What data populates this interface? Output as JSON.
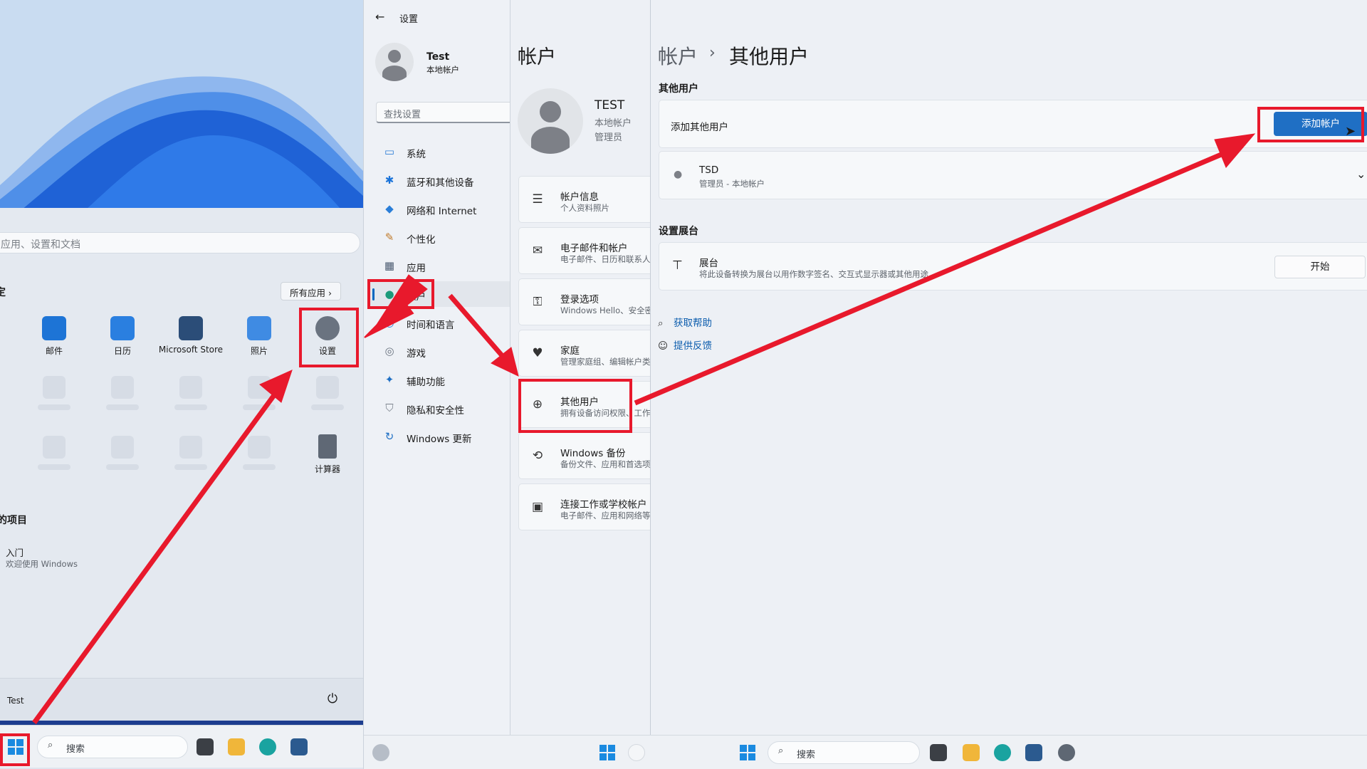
{
  "start_menu": {
    "search_placeholder": "应用、设置和文档",
    "pinned_title": "定",
    "all_apps_label": "所有应用",
    "apps": [
      {
        "label": "邮件"
      },
      {
        "label": "日历"
      },
      {
        "label": "Microsoft Store"
      },
      {
        "label": "照片"
      },
      {
        "label": "设置"
      },
      {
        "label": "计算器"
      }
    ],
    "recommended_title": "的项目",
    "recommended_item": {
      "name": "入门",
      "desc": "欢迎使用 Windows"
    },
    "user_name": "Test",
    "power_icon": "power-icon"
  },
  "taskbar": {
    "search_label": "搜索"
  },
  "settings_nav": {
    "title": "设置",
    "user_name": "Test",
    "user_type": "本地帐户",
    "find_placeholder": "查找设置",
    "items": [
      {
        "label": "系统",
        "icon": "system-icon"
      },
      {
        "label": "蓝牙和其他设备",
        "icon": "bluetooth-icon"
      },
      {
        "label": "网络和 Internet",
        "icon": "wifi-icon"
      },
      {
        "label": "个性化",
        "icon": "brush-icon"
      },
      {
        "label": "应用",
        "icon": "apps-icon"
      },
      {
        "label": "帐户",
        "icon": "person-icon",
        "selected": true
      },
      {
        "label": "时间和语言",
        "icon": "clock-icon"
      },
      {
        "label": "游戏",
        "icon": "gamepad-icon"
      },
      {
        "label": "辅助功能",
        "icon": "accessibility-icon"
      },
      {
        "label": "隐私和安全性",
        "icon": "shield-icon"
      },
      {
        "label": "Windows 更新",
        "icon": "update-icon"
      }
    ]
  },
  "accounts": {
    "title": "帐户",
    "user_name": "TEST",
    "user_type": "本地帐户",
    "user_role": "管理员",
    "items": [
      {
        "title": "帐户信息",
        "desc": "个人资料照片"
      },
      {
        "title": "电子邮件和帐户",
        "desc": "电子邮件、日历和联系人"
      },
      {
        "title": "登录选项",
        "desc": "Windows Hello、安全密"
      },
      {
        "title": "家庭",
        "desc": "管理家庭组、编辑帐户类"
      },
      {
        "title": "其他用户",
        "desc": "拥有设备访问权限、工作"
      },
      {
        "title": "Windows 备份",
        "desc": "备份文件、应用和首选项"
      },
      {
        "title": "连接工作或学校帐户",
        "desc": "电子邮件、应用和网络等"
      }
    ]
  },
  "other_users": {
    "breadcrumb_parent": "帐户",
    "breadcrumb_sep": "›",
    "breadcrumb_current": "其他用户",
    "section_other": "其他用户",
    "add_other_label": "添加其他用户",
    "add_account_button": "添加帐户",
    "user_entry": {
      "name": "TSD",
      "desc": "管理员 - 本地帐户"
    },
    "section_kiosk": "设置展台",
    "kiosk": {
      "title": "展台",
      "desc": "将此设备转换为展台以用作数字签名、交互式显示器或其他用途",
      "button": "开始"
    },
    "links": [
      {
        "label": "获取帮助",
        "icon": "help-icon"
      },
      {
        "label": "提供反馈",
        "icon": "feedback-icon"
      }
    ]
  },
  "colors": {
    "accent": "#1f6fc4",
    "highlight": "#e8192c"
  }
}
